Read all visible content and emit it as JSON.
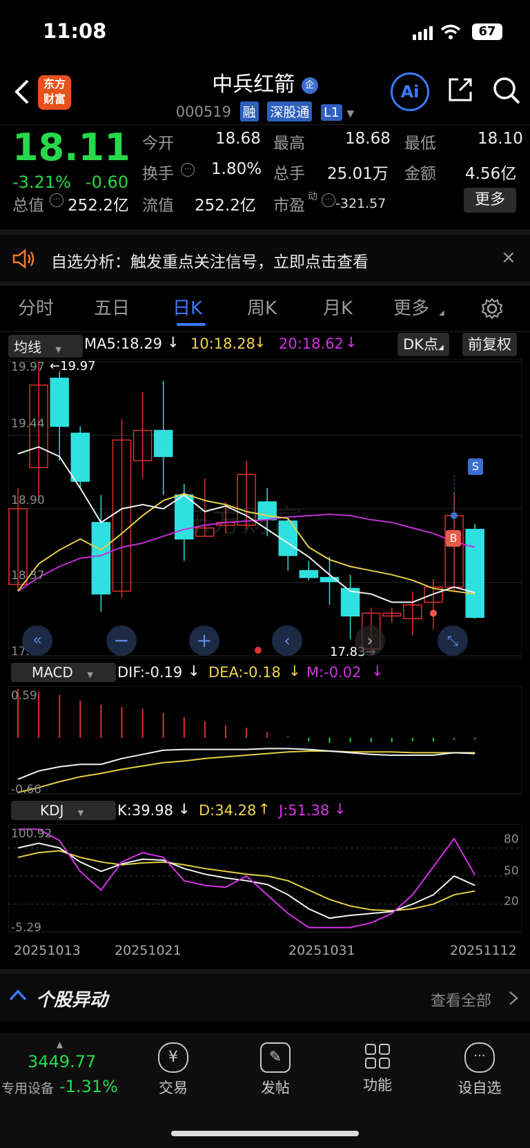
{
  "status": {
    "time": "11:08",
    "battery": "67"
  },
  "header": {
    "title": "中兵红箭",
    "badge": "企",
    "code": "000519",
    "tags": [
      "融",
      "深股通",
      "L1"
    ],
    "logo_line1": "东方",
    "logo_line2": "财富",
    "ai_label": "Ai"
  },
  "quote": {
    "price": "18.11",
    "change_pct": "-3.21%",
    "change": "-0.60",
    "rows": [
      [
        {
          "l": "今开",
          "v": "18.68",
          "c": "green"
        },
        {
          "l": "最高",
          "v": "18.68",
          "c": "green"
        },
        {
          "l": "最低",
          "v": "18.10",
          "c": "green"
        }
      ],
      [
        {
          "l": "换手",
          "v": "1.80%",
          "c": "white"
        },
        {
          "l": "总手",
          "v": "25.01万",
          "c": "white"
        },
        {
          "l": "金额",
          "v": "4.56亿",
          "c": "white"
        }
      ],
      [
        {
          "l": "总值",
          "v": "252.2亿",
          "c": "white"
        },
        {
          "l": "流值",
          "v": "252.2亿",
          "c": "white"
        },
        {
          "l": "市盈",
          "v": "-321.57",
          "c": "white"
        }
      ]
    ],
    "pe_sup": "动",
    "more_button": "更多"
  },
  "notice": {
    "text": "自选分析：触发重点关注信号，立即点击查看"
  },
  "tabs": [
    "分时",
    "五日",
    "日K",
    "周K",
    "月K",
    "更多"
  ],
  "active_tab": "日K",
  "kline": {
    "indicator_select": "均线",
    "ma5": "MA5:18.29",
    "ma10": "10:18.28",
    "ma20": "20:18.62",
    "dk_button": "DK点",
    "fq_button": "前复权",
    "y_labels": [
      "19.97",
      "19.44",
      "18.90",
      "18.37",
      "17.83"
    ],
    "high_marker": "←19.97",
    "low_marker": "17.83→",
    "signal_s": "S",
    "signal_b": "B",
    "watermark": "东方财富"
  },
  "chart_data": {
    "type": "candlestick",
    "ylim": [
      17.83,
      19.97
    ],
    "candles": [
      {
        "o": 18.35,
        "c": 18.9,
        "h": 19.05,
        "l": 18.3
      },
      {
        "o": 19.2,
        "c": 19.8,
        "h": 19.97,
        "l": 18.95
      },
      {
        "o": 19.85,
        "c": 19.5,
        "h": 19.9,
        "l": 19.25
      },
      {
        "o": 19.45,
        "c": 19.1,
        "h": 19.5,
        "l": 19.05
      },
      {
        "o": 18.8,
        "c": 18.28,
        "h": 19.0,
        "l": 18.15
      },
      {
        "o": 18.3,
        "c": 19.4,
        "h": 19.55,
        "l": 18.25
      },
      {
        "o": 19.25,
        "c": 19.47,
        "h": 19.75,
        "l": 19.12
      },
      {
        "o": 19.47,
        "c": 19.28,
        "h": 19.83,
        "l": 19.0
      },
      {
        "o": 19.0,
        "c": 18.68,
        "h": 19.08,
        "l": 18.52
      },
      {
        "o": 18.7,
        "c": 18.76,
        "h": 19.12,
        "l": 18.7
      },
      {
        "o": 18.78,
        "c": 18.8,
        "h": 18.95,
        "l": 18.72
      },
      {
        "o": 18.78,
        "c": 19.15,
        "h": 19.25,
        "l": 18.75
      },
      {
        "o": 18.95,
        "c": 18.82,
        "h": 19.05,
        "l": 18.7
      },
      {
        "o": 18.81,
        "c": 18.56,
        "h": 18.83,
        "l": 18.45
      },
      {
        "o": 18.45,
        "c": 18.4,
        "h": 18.52,
        "l": 18.38
      },
      {
        "o": 18.4,
        "c": 18.37,
        "h": 18.55,
        "l": 18.2
      },
      {
        "o": 18.32,
        "c": 18.12,
        "h": 18.42,
        "l": 17.95
      },
      {
        "o": 17.88,
        "c": 18.14,
        "h": 18.18,
        "l": 17.83
      },
      {
        "o": 18.12,
        "c": 18.14,
        "h": 18.18,
        "l": 18.07
      },
      {
        "o": 18.1,
        "c": 18.2,
        "h": 18.3,
        "l": 17.98
      },
      {
        "o": 18.22,
        "c": 18.33,
        "h": 18.39,
        "l": 18.02
      },
      {
        "o": 18.33,
        "c": 18.85,
        "h": 19.02,
        "l": 18.29
      },
      {
        "o": 18.75,
        "c": 18.11,
        "h": 18.79,
        "l": 18.1
      }
    ],
    "ma5": [
      19.3,
      19.35,
      19.28,
      19.05,
      18.8,
      18.9,
      18.93,
      18.9,
      19.0,
      18.88,
      18.92,
      18.85,
      18.75,
      18.65,
      18.55,
      18.42,
      18.3,
      18.28,
      18.22,
      18.22,
      18.28,
      18.33,
      18.29
    ],
    "ma10": [
      18.3,
      18.5,
      18.6,
      18.68,
      18.6,
      18.72,
      18.85,
      18.96,
      19.01,
      18.96,
      18.93,
      18.88,
      18.85,
      18.83,
      18.62,
      18.53,
      18.48,
      18.45,
      18.42,
      18.38,
      18.32,
      18.3,
      18.28
    ],
    "ma20": [
      18.3,
      18.4,
      18.48,
      18.54,
      18.56,
      18.62,
      18.65,
      18.7,
      18.75,
      18.78,
      18.8,
      18.81,
      18.82,
      18.84,
      18.85,
      18.86,
      18.85,
      18.82,
      18.8,
      18.76,
      18.72,
      18.66,
      18.62
    ]
  },
  "macd": {
    "select": "MACD",
    "dif": "DIF:-0.19",
    "dea": "DEA:-0.18",
    "m": "M:-0.02",
    "y_top": "0.59",
    "y_bottom": "-0.66",
    "bars": [
      0.59,
      0.55,
      0.52,
      0.45,
      0.4,
      0.37,
      0.35,
      0.3,
      0.25,
      0.2,
      0.15,
      0.12,
      0.07,
      0.02,
      -0.04,
      -0.06,
      -0.05,
      -0.05,
      -0.05,
      -0.04,
      -0.04,
      -0.02,
      -0.02
    ],
    "dif_line": [
      -0.5,
      -0.4,
      -0.35,
      -0.32,
      -0.32,
      -0.25,
      -0.2,
      -0.15,
      -0.14,
      -0.14,
      -0.14,
      -0.14,
      -0.13,
      -0.13,
      -0.14,
      -0.16,
      -0.18,
      -0.2,
      -0.21,
      -0.21,
      -0.21,
      -0.18,
      -0.19
    ],
    "dea_line": [
      -0.66,
      -0.6,
      -0.53,
      -0.47,
      -0.43,
      -0.38,
      -0.34,
      -0.3,
      -0.28,
      -0.25,
      -0.23,
      -0.21,
      -0.19,
      -0.17,
      -0.16,
      -0.16,
      -0.17,
      -0.17,
      -0.17,
      -0.18,
      -0.18,
      -0.18,
      -0.18
    ]
  },
  "kdj": {
    "select": "KDJ",
    "k": "K:39.98",
    "d": "D:34.28",
    "j": "J:51.38",
    "y_top": "100.92",
    "y_bottom": "-5.29",
    "levels": [
      "80",
      "50",
      "20"
    ],
    "k_line": [
      80,
      85,
      80,
      65,
      55,
      63,
      68,
      67,
      58,
      52,
      48,
      45,
      41,
      30,
      15,
      5,
      8,
      10,
      12,
      20,
      30,
      50,
      40
    ],
    "d_line": [
      70,
      75,
      77,
      70,
      65,
      62,
      64,
      65,
      62,
      58,
      55,
      52,
      50,
      45,
      35,
      25,
      18,
      14,
      13,
      15,
      20,
      30,
      34
    ],
    "j_line": [
      100,
      100,
      88,
      55,
      35,
      65,
      75,
      70,
      45,
      40,
      38,
      50,
      30,
      10,
      -5,
      -5,
      -5,
      0,
      10,
      30,
      60,
      90,
      51
    ]
  },
  "x_dates": [
    "20251013",
    "20251021",
    "20251031",
    "20251112"
  ],
  "movers": {
    "title": "个股异动",
    "link": "查看全部"
  },
  "bottom": {
    "index_value": "3449.77",
    "index_label": "专用设备",
    "index_change": "-1.31%",
    "nav": [
      "交易",
      "发帖",
      "功能",
      "设自选"
    ]
  }
}
